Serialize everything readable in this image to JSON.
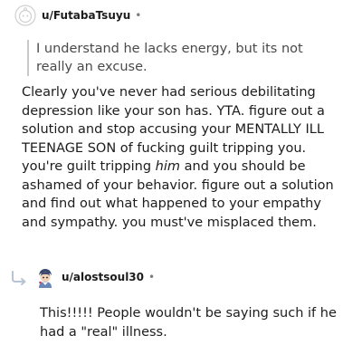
{
  "comments": [
    {
      "username": "u/FutabaTsuyu",
      "separator": "•",
      "avatar_icon": "default-avatar-icon",
      "quote": "I understand he lacks energy, but its not really an excuse.",
      "body_part1": "Clearly you've never had serious debilitating depression like your son has. YTA. figure out a solution and stop accusing your MENTALLY ILL TEENAGE SON of fucking guilt tripping you. you're guilt tripping ",
      "body_emphasis": "him",
      "body_part2": " and you should be ashamed of your behavior. figure out a solution and find out what happened to your empathy and sympathy. you must've misplaced them."
    },
    {
      "username": "u/alostsoul30",
      "separator": "•",
      "avatar_icon": "character-avatar-icon",
      "reply_icon": "reply-arrow-icon",
      "body": "This!!!!! People wouldn't be saying such if he had a \"real\" illness."
    }
  ]
}
